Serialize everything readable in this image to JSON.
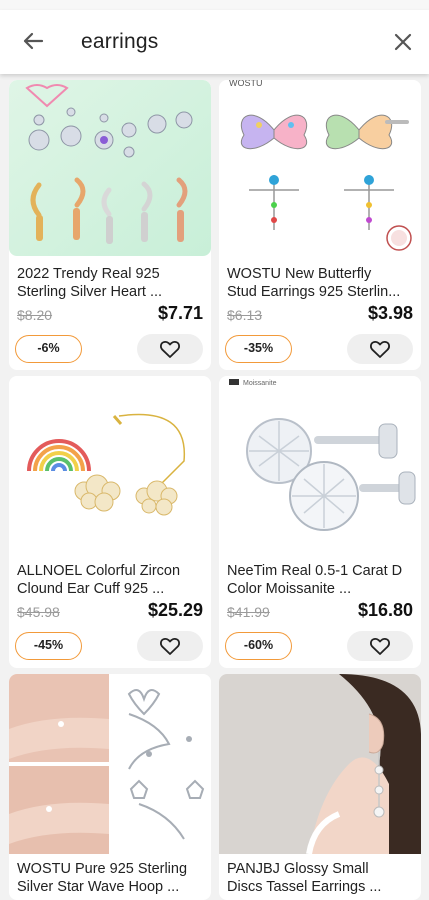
{
  "search": {
    "query": "earrings"
  },
  "products": [
    {
      "title": "2022 Trendy Real 925\nSterling Silver Heart ...",
      "old_price": "$8.20",
      "price": "$7.71",
      "discount": "-6%"
    },
    {
      "title": "WOSTU New Butterfly\nStud Earrings 925 Sterlin...",
      "old_price": "$6.13",
      "price": "$3.98",
      "discount": "-35%"
    },
    {
      "title": "ALLNOEL Colorful Zircon\nClound Ear Cuff 925 ...",
      "old_price": "$45.98",
      "price": "$25.29",
      "discount": "-45%"
    },
    {
      "title": "NeeTim Real 0.5-1 Carat D\nColor Moissanite ...",
      "old_price": "$41.99",
      "price": "$16.80",
      "discount": "-60%"
    },
    {
      "title": "WOSTU Pure 925 Sterling\nSilver Star Wave Hoop ..."
    },
    {
      "title": "PANJBJ Glossy Small\nDiscs Tassel Earrings ..."
    }
  ],
  "image_text": {
    "brand_wostu": "WOSTU",
    "badge_moissanite": "Moissanite"
  },
  "colors": {
    "discount_border": "#f29a3a",
    "fav_bg": "#efefef"
  }
}
